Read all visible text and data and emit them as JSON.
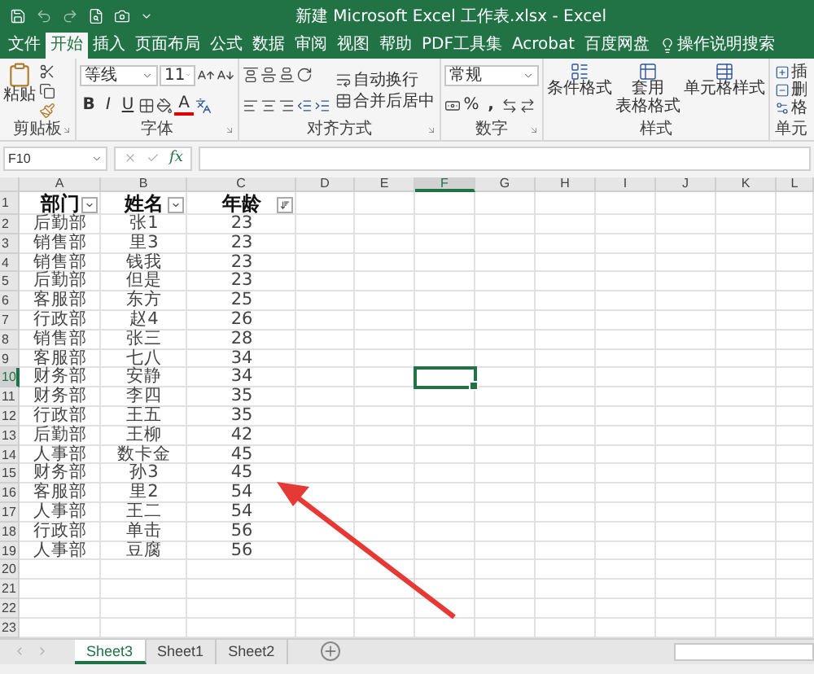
{
  "title_bar": {
    "title": "新建 Microsoft Excel 工作表.xlsx  -  Excel"
  },
  "ribbon_tabs": [
    {
      "label": "文件",
      "selected": false
    },
    {
      "label": "开始",
      "selected": true
    },
    {
      "label": "插入",
      "selected": false
    },
    {
      "label": "页面布局",
      "selected": false
    },
    {
      "label": "公式",
      "selected": false
    },
    {
      "label": "数据",
      "selected": false
    },
    {
      "label": "审阅",
      "selected": false
    },
    {
      "label": "视图",
      "selected": false
    },
    {
      "label": "帮助",
      "selected": false
    },
    {
      "label": "PDF工具集",
      "selected": false
    },
    {
      "label": "Acrobat",
      "selected": false
    },
    {
      "label": "百度网盘",
      "selected": false
    }
  ],
  "tell_me": "操作说明搜索",
  "ribbon": {
    "clipboard": {
      "paste": "粘贴",
      "label": "剪贴板"
    },
    "font": {
      "font_name": "等线",
      "font_size": "11",
      "bold": "B",
      "italic": "I",
      "underline": "U",
      "font_color": "A",
      "label": "字体"
    },
    "alignment": {
      "wrap_text": "自动换行",
      "merge": "合并后居中",
      "label": "对齐方式"
    },
    "number": {
      "format": "常规",
      "percent": "%",
      "comma": ",",
      "label": "数字"
    },
    "styles": {
      "buttons": [
        {
          "lines": [
            "条件格式"
          ]
        },
        {
          "lines": [
            "套用",
            "表格格式"
          ]
        },
        {
          "lines": [
            "单元格样式"
          ]
        }
      ],
      "label": "样式"
    },
    "cells": {
      "buttons": [
        "插",
        "删",
        "格"
      ],
      "label": "单元"
    }
  },
  "formula_bar": {
    "name_box": "F10",
    "insert_function": "fx"
  },
  "sheet": {
    "columns": [
      {
        "label": "A",
        "selected": false
      },
      {
        "label": "B",
        "selected": false
      },
      {
        "label": "C",
        "selected": false
      },
      {
        "label": "D",
        "selected": false
      },
      {
        "label": "E",
        "selected": false
      },
      {
        "label": "F",
        "selected": true
      },
      {
        "label": "G",
        "selected": false
      },
      {
        "label": "H",
        "selected": false
      },
      {
        "label": "I",
        "selected": false
      },
      {
        "label": "J",
        "selected": false
      },
      {
        "label": "K",
        "selected": false
      },
      {
        "label": "L",
        "selected": false
      }
    ],
    "header_row": {
      "number": "1",
      "cells": [
        {
          "text": "部门",
          "kind": "dropdown"
        },
        {
          "text": "姓名",
          "kind": "dropdown"
        },
        {
          "text": "年龄",
          "kind": "sorted"
        }
      ]
    },
    "rows": [
      {
        "number": "2",
        "selected": false,
        "cells": [
          "后勤部",
          "张1",
          "23"
        ]
      },
      {
        "number": "3",
        "selected": false,
        "cells": [
          "销售部",
          "里3",
          "23"
        ]
      },
      {
        "number": "4",
        "selected": false,
        "cells": [
          "销售部",
          "钱我",
          "23"
        ]
      },
      {
        "number": "5",
        "selected": false,
        "cells": [
          "后勤部",
          "但是",
          "23"
        ]
      },
      {
        "number": "6",
        "selected": false,
        "cells": [
          "客服部",
          "东方",
          "25"
        ]
      },
      {
        "number": "7",
        "selected": false,
        "cells": [
          "行政部",
          "赵4",
          "26"
        ]
      },
      {
        "number": "8",
        "selected": false,
        "cells": [
          "销售部",
          "张三",
          "28"
        ]
      },
      {
        "number": "9",
        "selected": false,
        "cells": [
          "客服部",
          "七八",
          "34"
        ]
      },
      {
        "number": "10",
        "selected": true,
        "cells": [
          "财务部",
          "安静",
          "34"
        ]
      },
      {
        "number": "11",
        "selected": false,
        "cells": [
          "财务部",
          "李四",
          "35"
        ]
      },
      {
        "number": "12",
        "selected": false,
        "cells": [
          "行政部",
          "王五",
          "35"
        ]
      },
      {
        "number": "13",
        "selected": false,
        "cells": [
          "后勤部",
          "王柳",
          "42"
        ]
      },
      {
        "number": "14",
        "selected": false,
        "cells": [
          "人事部",
          "数卡金",
          "45"
        ]
      },
      {
        "number": "15",
        "selected": false,
        "cells": [
          "财务部",
          "孙3",
          "45"
        ]
      },
      {
        "number": "16",
        "selected": false,
        "cells": [
          "客服部",
          "里2",
          "54"
        ]
      },
      {
        "number": "17",
        "selected": false,
        "cells": [
          "人事部",
          "王二",
          "54"
        ]
      },
      {
        "number": "18",
        "selected": false,
        "cells": [
          "行政部",
          "单击",
          "56"
        ]
      },
      {
        "number": "19",
        "selected": false,
        "cells": [
          "人事部",
          "豆腐",
          "56"
        ]
      },
      {
        "number": "20",
        "selected": false,
        "cells": []
      },
      {
        "number": "21",
        "selected": false,
        "cells": []
      },
      {
        "number": "22",
        "selected": false,
        "cells": []
      },
      {
        "number": "23",
        "selected": false,
        "cells": []
      }
    ]
  },
  "annotation": {
    "kind": "arrow"
  },
  "sheet_tabs": [
    {
      "label": "Sheet3",
      "selected": true
    },
    {
      "label": "Sheet1",
      "selected": false
    },
    {
      "label": "Sheet2",
      "selected": false
    }
  ]
}
